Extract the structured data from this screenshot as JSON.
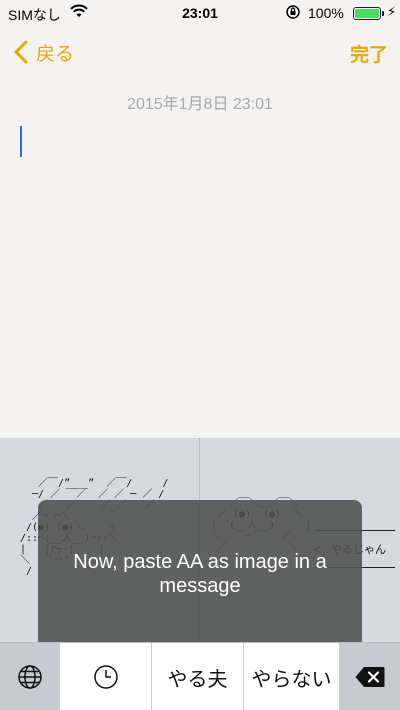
{
  "status_bar": {
    "carrier": "SIMなし",
    "time": "23:01",
    "battery_percent": "100%",
    "battery_color": "#4cd964"
  },
  "nav": {
    "back_label": "戻る",
    "done_label": "完了",
    "accent_color": "#e6a800"
  },
  "note": {
    "date": "2015年1月8日 23:01"
  },
  "aa_panels": {
    "left_icon": "yaruo-ascii-art",
    "right_icon": "yaranai-ascii-art",
    "right_callout": "やるじゃん"
  },
  "toast": {
    "message": "Now, paste AA as image in a message"
  },
  "keyboard": {
    "keys": [
      {
        "label": "",
        "icon": "globe-icon"
      },
      {
        "label": "",
        "icon": "clock-icon"
      },
      {
        "label": "やる夫",
        "icon": ""
      },
      {
        "label": "やらない",
        "icon": ""
      },
      {
        "label": "",
        "icon": "delete-backspace-icon"
      }
    ]
  }
}
